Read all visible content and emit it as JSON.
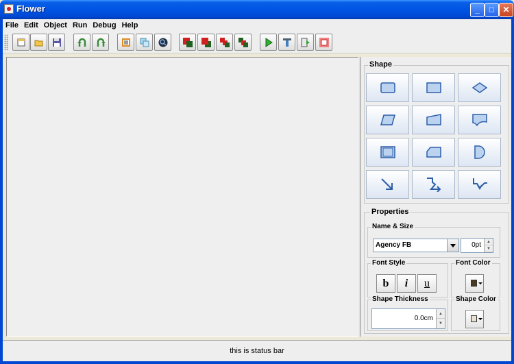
{
  "window": {
    "title": "Flower"
  },
  "menu": [
    "File",
    "Edit",
    "Object",
    "Run",
    "Debug",
    "Help"
  ],
  "toolbar": {
    "buttons": [
      {
        "name": "new-file-icon"
      },
      {
        "name": "open-folder-icon"
      },
      {
        "name": "save-icon"
      },
      {
        "name": "undo-icon"
      },
      {
        "name": "redo-icon"
      },
      {
        "name": "notes-icon"
      },
      {
        "name": "copy-icon"
      },
      {
        "name": "zoom-icon"
      },
      {
        "name": "bring-front-icon"
      },
      {
        "name": "send-back-icon"
      },
      {
        "name": "layer-up-icon"
      },
      {
        "name": "layer-down-icon"
      },
      {
        "name": "run-icon"
      },
      {
        "name": "debug-icon"
      },
      {
        "name": "step-icon"
      },
      {
        "name": "stop-icon"
      }
    ]
  },
  "shape_panel": {
    "title": "Shape",
    "shapes": [
      "rectangle",
      "rounded-rectangle",
      "diamond",
      "parallelogram",
      "manual-input",
      "document",
      "subroutine",
      "card",
      "delay",
      "arrow-down-right",
      "connector-right",
      "connector-down"
    ]
  },
  "properties": {
    "title": "Properties",
    "name_size_label": "Name & Size",
    "font_value": "Agency FB",
    "size_value": "0pt",
    "font_style_label": "Font Style",
    "bold_label": "b",
    "italic_label": "i",
    "underline_label": "u",
    "font_color_label": "Font Color",
    "thickness_label": "Shape Thickness",
    "thickness_value": "0.0cm",
    "shape_color_label": "Shape Color",
    "shape_color": "#e8e0d0"
  },
  "status": {
    "text": "this is status bar"
  }
}
